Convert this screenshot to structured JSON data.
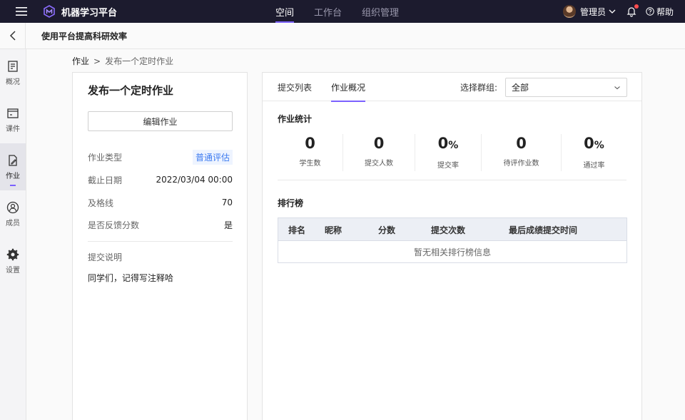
{
  "topbar": {
    "brand": "机器学习平台",
    "nav": [
      "空间",
      "工作台",
      "组织管理"
    ],
    "active_nav": 0,
    "user": "管理员",
    "help": "帮助"
  },
  "subheader": {
    "title": "使用平台提高科研效率"
  },
  "sidebar": {
    "items": [
      {
        "label": "概况",
        "icon": "overview-icon"
      },
      {
        "label": "课件",
        "icon": "courseware-icon"
      },
      {
        "label": "作业",
        "icon": "assignment-icon"
      },
      {
        "label": "成员",
        "icon": "member-icon"
      },
      {
        "label": "设置",
        "icon": "settings-icon"
      }
    ],
    "active": 2
  },
  "breadcrumb": {
    "parent": "作业",
    "separator": ">",
    "current": "发布一个定时作业"
  },
  "left_card": {
    "title": "发布一个定时作业",
    "edit_button": "编辑作业",
    "rows": [
      {
        "key": "作业类型",
        "value": "普通评估"
      },
      {
        "key": "截止日期",
        "value": "2022/03/04 00:00"
      },
      {
        "key": "及格线",
        "value": "70"
      },
      {
        "key": "是否反馈分数",
        "value": "是"
      }
    ],
    "desc_label": "提交说明",
    "desc_text": "同学们，记得写注释哈"
  },
  "right_card": {
    "tabs": [
      "提交列表",
      "作业概况"
    ],
    "active_tab": 1,
    "group_label": "选择群组:",
    "group_value": "全部",
    "stats_title": "作业统计",
    "stats": [
      {
        "value": "0",
        "unit": "",
        "label": "学生数"
      },
      {
        "value": "0",
        "unit": "",
        "label": "提交人数"
      },
      {
        "value": "0",
        "unit": "%",
        "label": "提交率"
      },
      {
        "value": "0",
        "unit": "",
        "label": "待评作业数"
      },
      {
        "value": "0",
        "unit": "%",
        "label": "通过率"
      }
    ],
    "rank_title": "排行榜",
    "table_headers": [
      "排名",
      "昵称",
      "分数",
      "提交次数",
      "最后成绩提交时间"
    ],
    "empty_text": "暂无相关排行榜信息"
  },
  "colors": {
    "accent": "#7b61ff",
    "topbar": "#1c1b2e",
    "tag_text": "#3d7bf0",
    "tag_bg": "#eef4ff"
  }
}
